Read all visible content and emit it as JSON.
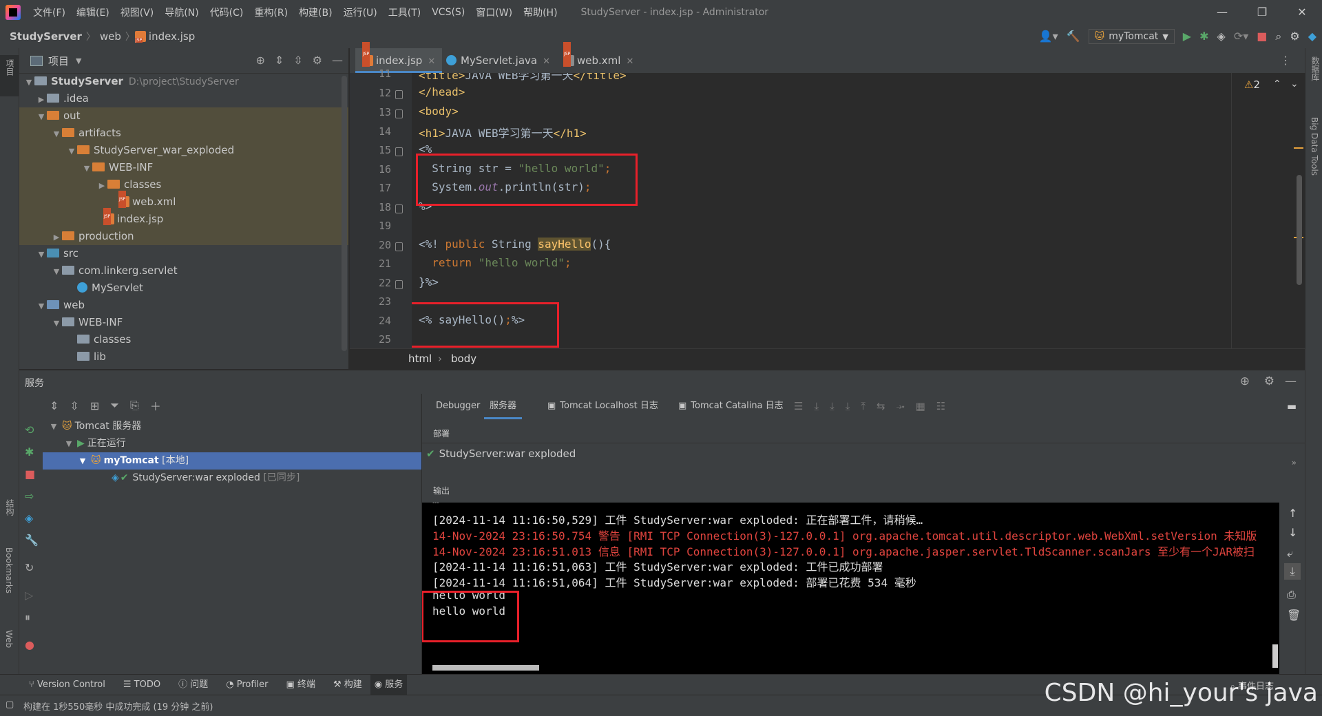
{
  "window": {
    "title": "StudyServer - index.jsp - Administrator",
    "menu": [
      "文件(F)",
      "编辑(E)",
      "视图(V)",
      "导航(N)",
      "代码(C)",
      "重构(R)",
      "构建(B)",
      "运行(U)",
      "工具(T)",
      "VCS(S)",
      "窗口(W)",
      "帮助(H)"
    ]
  },
  "navbar": {
    "crumbs": [
      "StudyServer",
      "web",
      "index.jsp"
    ],
    "run_config": "myTomcat"
  },
  "left_stripe": {
    "project": "项目",
    "structure": "结构",
    "bookmarks": "Bookmarks",
    "web": "Web"
  },
  "right_stripe": {
    "database": "数据库",
    "bigdata": "Big Data Tools"
  },
  "project": {
    "title": "项目",
    "root_name": "StudyServer",
    "root_path": "D:\\project\\StudyServer",
    "items": [
      ".idea",
      "out",
      "artifacts",
      "StudyServer_war_exploded",
      "WEB-INF",
      "classes",
      "web.xml",
      "index.jsp",
      "production",
      "src",
      "com.linkerg.servlet",
      "MyServlet",
      "web",
      "WEB-INF",
      "classes",
      "lib"
    ]
  },
  "editor": {
    "tabs": [
      "index.jsp",
      "MyServlet.java",
      "web.xml"
    ],
    "warnings": "2",
    "line_numbers": [
      "11",
      "12",
      "13",
      "14",
      "15",
      "16",
      "17",
      "18",
      "19",
      "20",
      "21",
      "22",
      "23",
      "24",
      "25"
    ],
    "breadcrumb": [
      "html",
      "body"
    ]
  },
  "services": {
    "title": "服务",
    "tree": {
      "root": "Tomcat 服务器",
      "running": "正在运行",
      "server": "myTomcat",
      "server_tag": "[本地]",
      "artifact": "StudyServer:war exploded",
      "artifact_tag": "[已同步]"
    },
    "tabs": [
      "Debugger",
      "服务器",
      "Tomcat Localhost 日志",
      "Tomcat Catalina 日志"
    ],
    "deploy_label": "部署",
    "deploy_item": "StudyServer:war exploded",
    "output_label": "输出",
    "console": [
      "[2024-11-14 11:16:50,529] 工件 StudyServer:war exploded: 正在部署工件，请稍候…",
      "14-Nov-2024 23:16:50.754 警告 [RMI TCP Connection(3)-127.0.0.1] org.apache.tomcat.util.descriptor.web.WebXml.setVersion 未知版",
      "14-Nov-2024 23:16:51.013 信息 [RMI TCP Connection(3)-127.0.0.1] org.apache.jasper.servlet.TldScanner.scanJars 至少有一个JAR被扫",
      "[2024-11-14 11:16:51,063] 工件 StudyServer:war exploded: 工件已成功部署",
      "[2024-11-14 11:16:51,064] 工件 StudyServer:war exploded: 部署已花费 534 毫秒",
      "hello world",
      "hello world"
    ]
  },
  "bottom_tabs": [
    "Version Control",
    "TODO",
    "问题",
    "Profiler",
    "终端",
    "构建",
    "服务"
  ],
  "status": {
    "message": "构建在 1秒550毫秒 中成功完成 (19 分钟 之前)",
    "event_log": "事件日志"
  },
  "watermark": "CSDN @hi_your's java",
  "colors": {
    "accent": "#4a88c7",
    "highlight_box": "#e8202a",
    "error_text": "#e0443e"
  }
}
